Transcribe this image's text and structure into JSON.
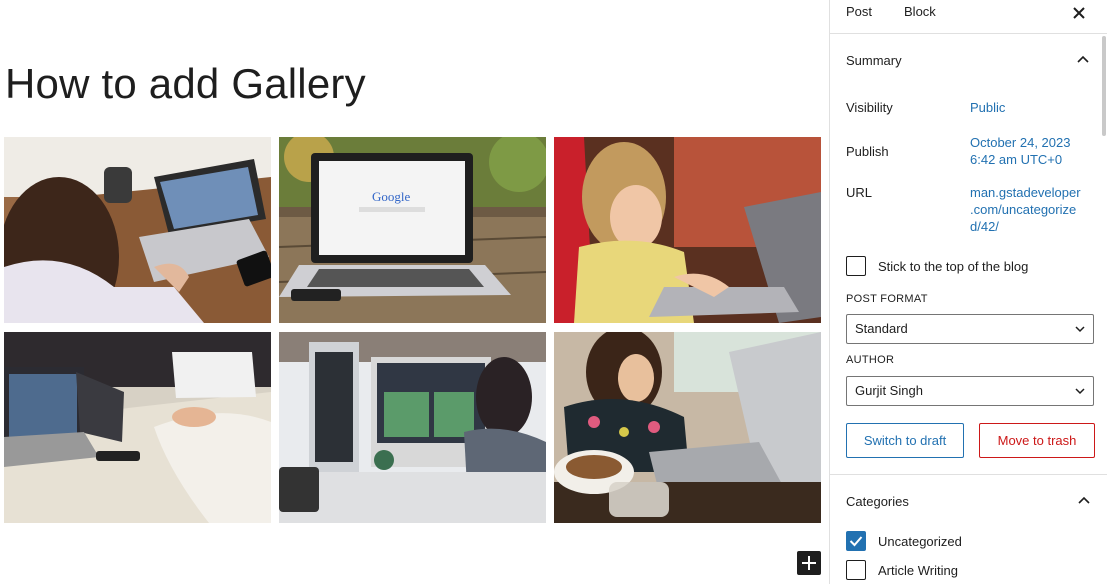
{
  "editor": {
    "post_title": "How to add Gallery",
    "gallery": [
      {
        "name": "woman-laptop-coffee"
      },
      {
        "name": "macbook-google"
      },
      {
        "name": "girl-laptop"
      },
      {
        "name": "meeting-laptops"
      },
      {
        "name": "woman-at-imac"
      },
      {
        "name": "woman-typing-coffee"
      }
    ]
  },
  "sidebar": {
    "tabs": [
      {
        "label": "Post"
      },
      {
        "label": "Block"
      }
    ],
    "summary": {
      "title": "Summary",
      "visibility_label": "Visibility",
      "visibility_value": "Public",
      "publish_label": "Publish",
      "publish_date": "October 24, 2023",
      "publish_time": "6:42 am UTC+0",
      "url_label": "URL",
      "url_line1": "man.gstadeveloper",
      "url_line2": ".com/uncategorize",
      "url_line3": "d/42/",
      "stick_label": "Stick to the top of the blog",
      "stick_checked": false,
      "post_format_label": "POST FORMAT",
      "post_format_value": "Standard",
      "author_label": "AUTHOR",
      "author_value": "Gurjit Singh",
      "switch_draft": "Switch to draft",
      "move_trash": "Move to trash"
    },
    "categories": {
      "title": "Categories",
      "items": [
        {
          "label": "Uncategorized",
          "checked": true
        },
        {
          "label": "Article Writing",
          "checked": false
        }
      ]
    }
  },
  "colors": {
    "accent": "#2271b1",
    "danger": "#cc1818",
    "text": "#1e1e1e"
  }
}
